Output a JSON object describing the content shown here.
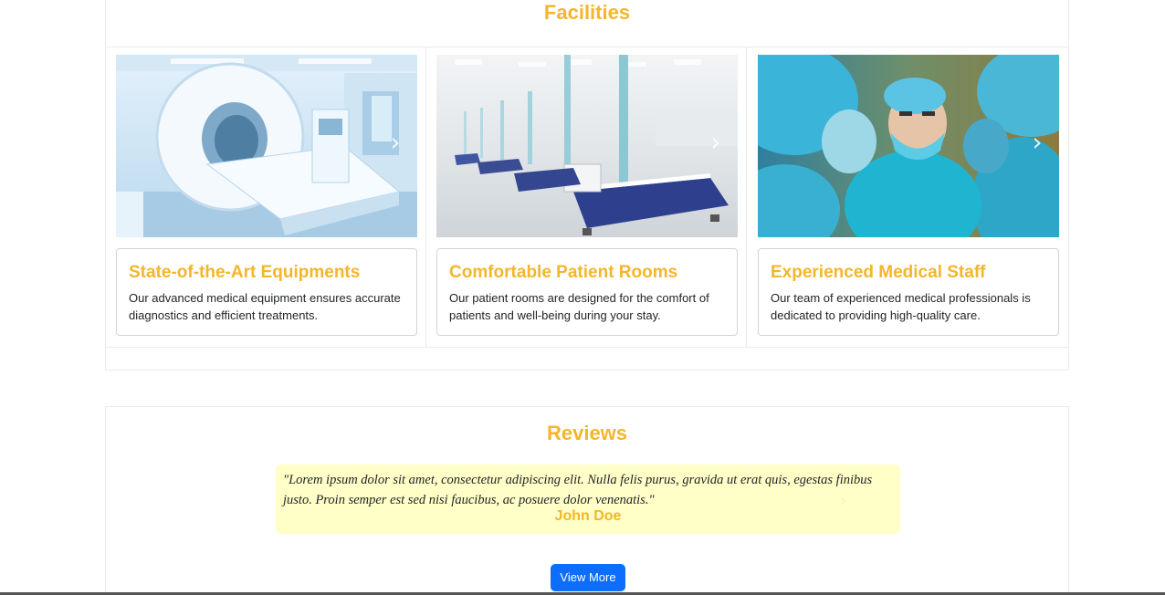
{
  "facilities": {
    "title": "Facilities",
    "items": [
      {
        "title": "State-of-the-Art Equipments",
        "description": "Our advanced medical equipment ensures accurate diagnostics and efficient treatments.",
        "image_icon": "mri-scanner-image"
      },
      {
        "title": "Comfortable Patient Rooms",
        "description": "Our patient rooms are designed for the comfort of patients and well-being during your stay.",
        "image_icon": "hospital-ward-image"
      },
      {
        "title": "Experienced Medical Staff",
        "description": "Our team of experienced medical professionals is dedicated to providing high-quality care.",
        "image_icon": "surgeons-image"
      }
    ],
    "next_glyph": "›"
  },
  "reviews": {
    "title": "Reviews",
    "quote": "\"Lorem ipsum dolor sit amet, consectetur adipiscing elit. Nulla felis purus, gravida ut erat quis, egestas finibus justo. Proin semper est sed nisi faucibus, ac posuere dolor venenatis.\"",
    "author": "John Doe",
    "view_more_label": "View More"
  },
  "colors": {
    "accent": "#f4b62a",
    "button": "#0d6efd",
    "review_background": "#ffffc7"
  }
}
